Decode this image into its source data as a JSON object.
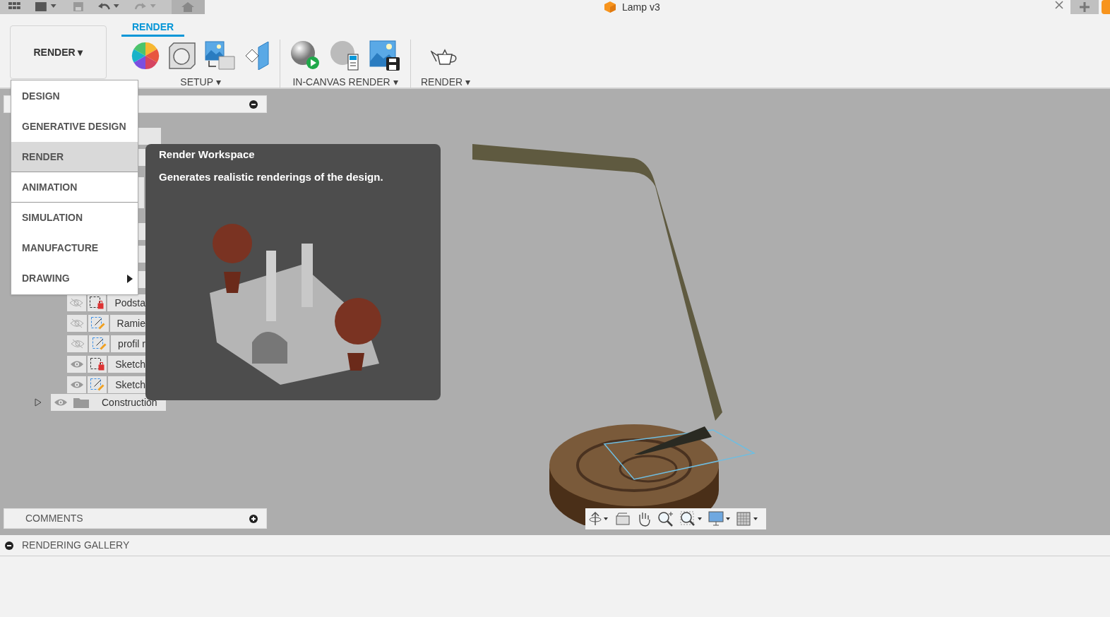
{
  "window": {
    "title": "Lamp v3"
  },
  "toolbar": {
    "workspace_button": "RENDER ▾",
    "tabs": [
      {
        "label": "RENDER",
        "selected": true
      }
    ],
    "groups": [
      {
        "label": "SETUP ▾"
      },
      {
        "label": "IN-CANVAS RENDER ▾"
      },
      {
        "label": "RENDER ▾"
      }
    ]
  },
  "workspace_menu": [
    {
      "label": "DESIGN",
      "selected": false,
      "submenu": false,
      "divider_after": false
    },
    {
      "label": "GENERATIVE DESIGN",
      "selected": false,
      "submenu": false,
      "divider_after": false
    },
    {
      "label": "RENDER",
      "selected": true,
      "submenu": false,
      "divider_after": true
    },
    {
      "label": "ANIMATION",
      "selected": false,
      "submenu": false,
      "divider_after": true
    },
    {
      "label": "SIMULATION",
      "selected": false,
      "submenu": false,
      "divider_after": false
    },
    {
      "label": "MANUFACTURE",
      "selected": false,
      "submenu": false,
      "divider_after": false
    },
    {
      "label": "DRAWING",
      "selected": false,
      "submenu": true,
      "divider_after": false
    }
  ],
  "tooltip": {
    "title": "Render Workspace",
    "description": "Generates realistic renderings of the design."
  },
  "browser": {
    "rows": [
      {
        "name": "Podsta",
        "visible": false,
        "locked": true
      },
      {
        "name": "Ramie",
        "visible": false,
        "locked": false
      },
      {
        "name": "profil r",
        "visible": false,
        "locked": false
      },
      {
        "name": "Sketch",
        "visible": true,
        "locked": true
      },
      {
        "name": "Sketch",
        "visible": true,
        "locked": false
      }
    ],
    "folder": {
      "name": "Construction",
      "visible": true,
      "expanded": false
    }
  },
  "comments": {
    "label": "COMMENTS"
  },
  "rendering_gallery": {
    "label": "RENDERING GALLERY"
  }
}
